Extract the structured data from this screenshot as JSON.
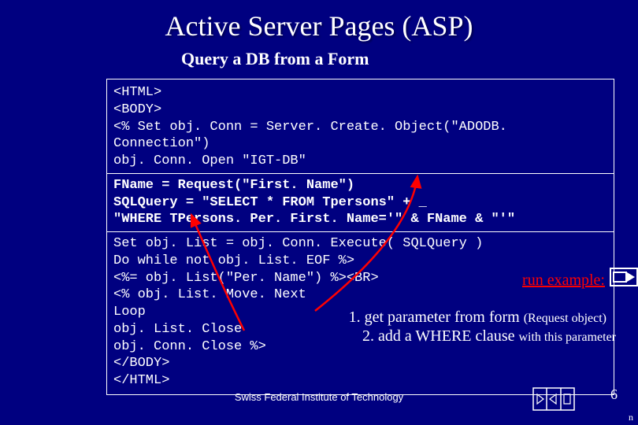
{
  "title": "Active Server Pages (ASP)",
  "subtitle": "Query a DB from a Form",
  "code": {
    "l1": "<HTML>",
    "l2": "<BODY>",
    "l3": "<% Set obj. Conn = Server. Create. Object(\"ADODB. Connection\")",
    "l4": "obj. Conn. Open \"IGT-DB\"",
    "b1": "FName = Request(\"First. Name\")",
    "b2": "SQLQuery = \"SELECT * FROM Tpersons\" + _",
    "b3": "   \"WHERE TPersons. Per. First. Name='\" & FName & \"'\"",
    "l5": "Set obj. List = obj. Conn. Execute( SQLQuery )",
    "l6": "Do while not obj. List. EOF %>",
    "l7": "<%= obj. List(\"Per. Name\") %><BR>",
    "l8": "<% obj. List. Move. Next",
    "l9": "Loop",
    "l10": "obj. List. Close",
    "l11": "obj. Conn. Close %>",
    "l12": "</BODY>",
    "l13": "</HTML>"
  },
  "run_label": "run example:",
  "annot1_main": "1. get parameter from form ",
  "annot1_small": "(Request object)",
  "annot2_main": "2. add a WHERE clause ",
  "annot2_small": "with this parameter",
  "footer_institution": "Swiss Federal Institute of Technology",
  "slide_number": "6",
  "corner_char": "n"
}
